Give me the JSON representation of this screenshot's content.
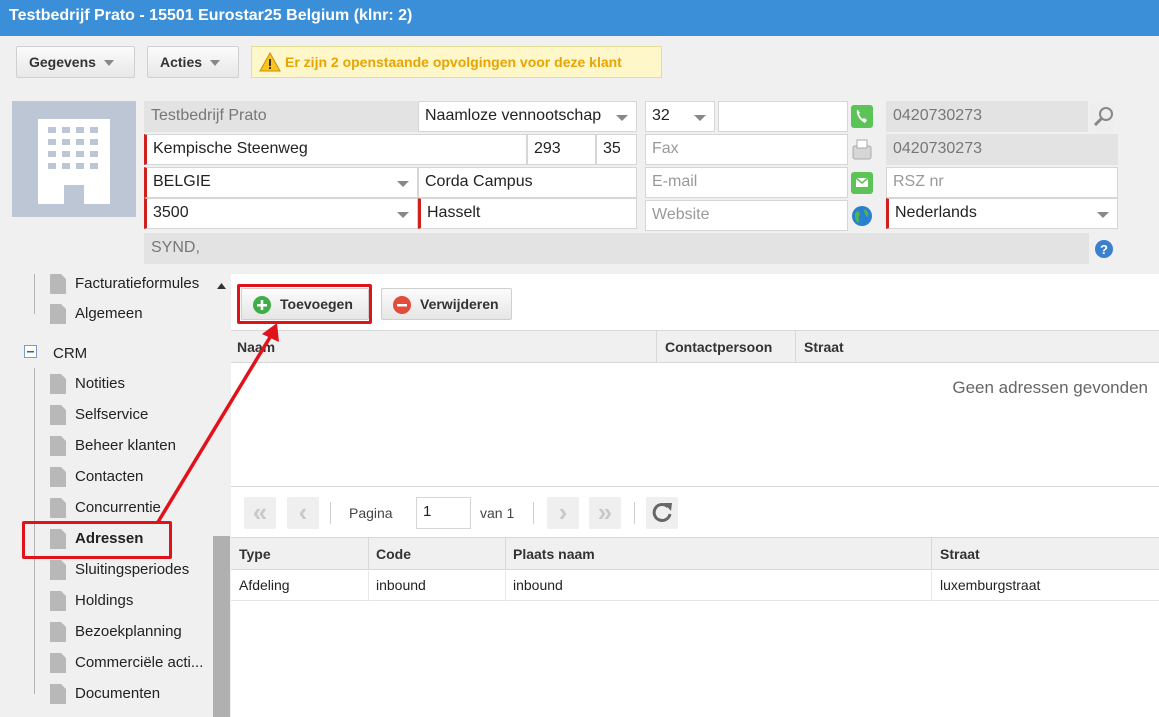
{
  "title": "Testbedrijf Prato - 15501 Eurostar25 Belgium (klnr: 2)",
  "toolbar": {
    "gegevens": "Gegevens",
    "acties": "Acties",
    "alert": "Er zijn 2 openstaande opvolgingen voor deze klant"
  },
  "form": {
    "company_name": "Testbedrijf Prato",
    "legal_form": "Naamloze vennootschap",
    "phone_prefix": "32",
    "phone": "",
    "vat": "0420730273",
    "street": "Kempische Steenweg",
    "house_number": "293",
    "box": "35",
    "fax_placeholder": "Fax",
    "company_number": "0420730273",
    "country": "BELGIE",
    "address_extra": "Corda Campus",
    "email_placeholder": "E-mail",
    "rsz_placeholder": "RSZ nr",
    "postal_code": "3500",
    "city": "Hasselt",
    "website_placeholder": "Website",
    "language": "Nederlands",
    "synd": "SYND,"
  },
  "sidebar": {
    "items": [
      {
        "label": "Facturatieformules"
      },
      {
        "label": "Algemeen"
      },
      {
        "label": "Notities"
      },
      {
        "label": "Selfservice"
      },
      {
        "label": "Beheer klanten"
      },
      {
        "label": "Contacten"
      },
      {
        "label": "Concurrentie"
      },
      {
        "label": "Adressen"
      },
      {
        "label": "Sluitingsperiodes"
      },
      {
        "label": "Holdings"
      },
      {
        "label": "Bezoekplanning"
      },
      {
        "label": "Commerciële acti..."
      },
      {
        "label": "Documenten"
      }
    ],
    "group": "CRM"
  },
  "actions": {
    "add": "Toevoegen",
    "delete": "Verwijderen"
  },
  "addresses": {
    "columns": [
      "Naam",
      "Contactpersoon",
      "Straat"
    ],
    "empty": "Geen adressen gevonden"
  },
  "pager": {
    "page_label": "Pagina",
    "page": "1",
    "of_label": "van 1"
  },
  "details": {
    "columns": [
      "Type",
      "Code",
      "Plaats naam",
      "Straat"
    ],
    "rows": [
      {
        "type": "Afdeling",
        "code": "inbound",
        "place": "inbound",
        "street": "luxemburgstraat"
      }
    ]
  },
  "colors": {
    "titlebar": "#3b8fd8",
    "highlight": "#e0121a",
    "alert_text": "#e8a400"
  }
}
